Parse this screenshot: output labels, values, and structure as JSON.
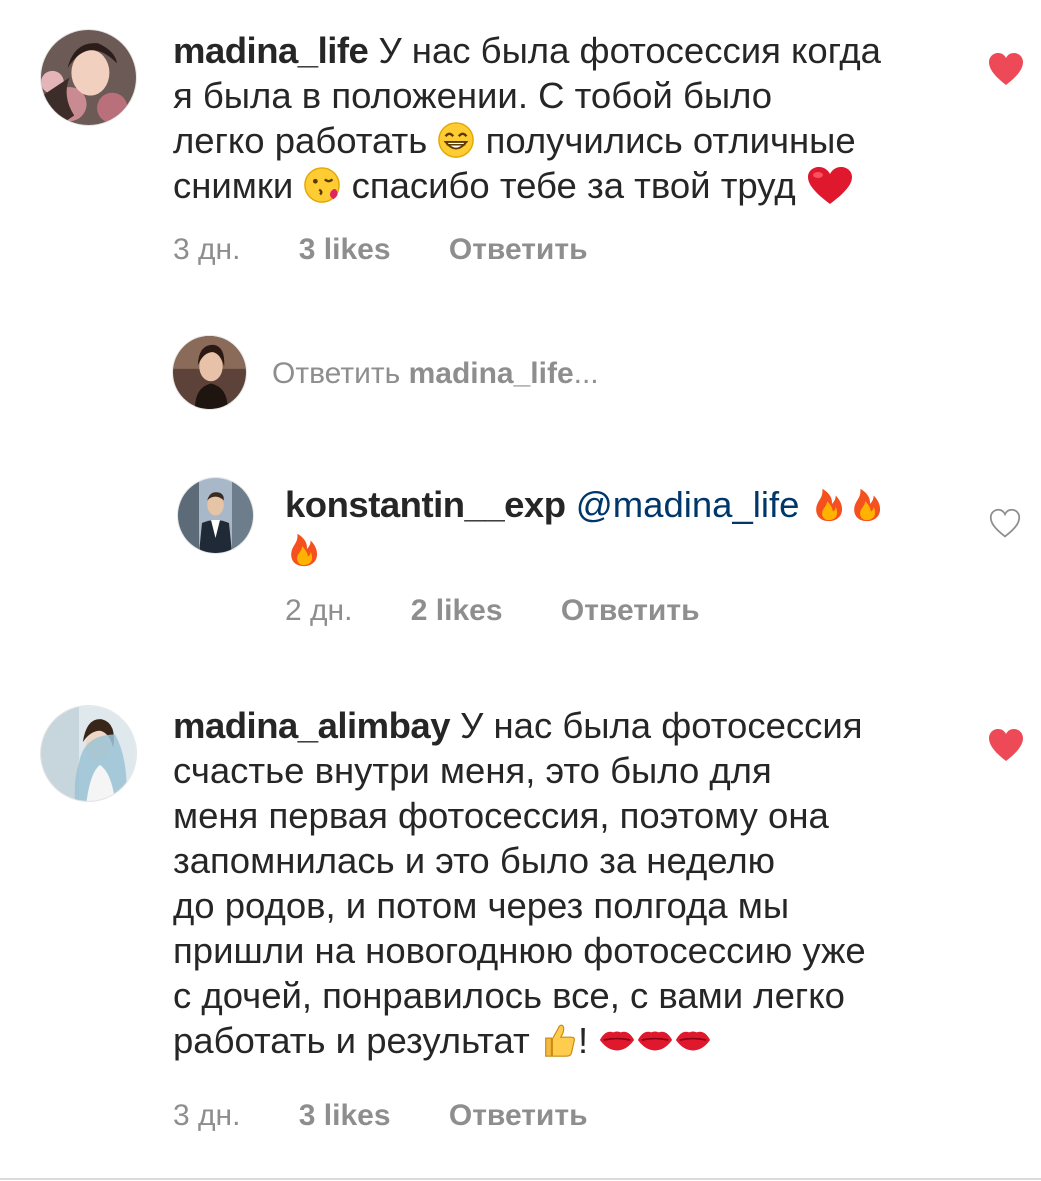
{
  "comments": [
    {
      "username": "madina_life",
      "text_lines": [
        "У нас была фотосессия когда",
        "я была в положении. С тобой было",
        "легко работать",
        "получились отличные",
        "снимки",
        "спасибо тебе за твой труд"
      ],
      "time": "3 дн.",
      "likes": "3 likes",
      "reply_label": "Ответить",
      "liked": true
    },
    {
      "username": "konstantin__exp",
      "mention": "@madina_life",
      "time": "2 дн.",
      "likes": "2 likes",
      "reply_label": "Ответить",
      "liked": false
    },
    {
      "username": "madina_alimbay",
      "text_lines": [
        "У нас была фотосессия",
        "счастье внутри меня, это было для",
        "меня первая фотосессия, поэтому она",
        "запомнилась и это было за неделю",
        "до родов, и потом через полгода мы",
        "пришли на новогоднюю фотосессию уже",
        "с дочей, понравилось все, с вами легко",
        "работать и результат",
        "!"
      ],
      "time": "3 дн.",
      "likes": "3 likes",
      "reply_label": "Ответить",
      "liked": true
    }
  ],
  "reply_composer": {
    "prefix": "Ответить",
    "target": "madina_life",
    "suffix": "..."
  },
  "icons": {
    "liked_heart": "heart-filled-icon",
    "unliked_heart": "heart-outline-icon",
    "emojis": [
      "grinning-face-emoji",
      "face-blowing-kiss-emoji",
      "red-heart-emoji",
      "fire-emoji",
      "thumbs-up-emoji",
      "kiss-mark-emoji"
    ]
  },
  "colors": {
    "text": "#262626",
    "muted": "#8e8e8e",
    "mention": "#00376b",
    "like_red": "#ed4956"
  }
}
